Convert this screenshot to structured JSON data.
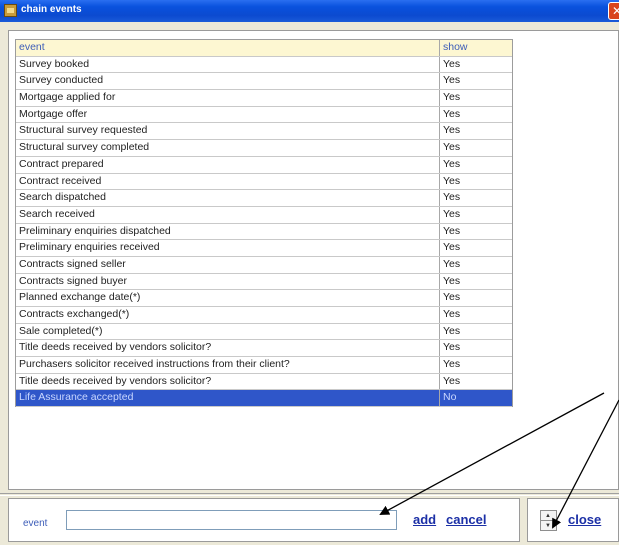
{
  "window": {
    "title": "chain events",
    "close_glyph": "✕"
  },
  "table": {
    "headers": {
      "event": "event",
      "show": "show"
    },
    "rows": [
      {
        "event": "Survey booked",
        "show": "Yes"
      },
      {
        "event": "Survey conducted",
        "show": "Yes"
      },
      {
        "event": "Mortgage applied for",
        "show": "Yes"
      },
      {
        "event": "Mortgage offer",
        "show": "Yes"
      },
      {
        "event": "Structural survey requested",
        "show": "Yes"
      },
      {
        "event": "Structural survey completed",
        "show": "Yes"
      },
      {
        "event": "Contract prepared",
        "show": "Yes"
      },
      {
        "event": "Contract received",
        "show": "Yes"
      },
      {
        "event": "Search dispatched",
        "show": "Yes"
      },
      {
        "event": "Search received",
        "show": "Yes"
      },
      {
        "event": "Preliminary enquiries dispatched",
        "show": "Yes"
      },
      {
        "event": "Preliminary enquiries received",
        "show": "Yes"
      },
      {
        "event": "Contracts signed seller",
        "show": "Yes"
      },
      {
        "event": "Contracts signed buyer",
        "show": "Yes"
      },
      {
        "event": "Planned exchange date(*)",
        "show": "Yes"
      },
      {
        "event": "Contracts exchanged(*)",
        "show": "Yes"
      },
      {
        "event": "Sale completed(*)",
        "show": "Yes"
      },
      {
        "event": "Title deeds received by vendors solicitor?",
        "show": "Yes"
      },
      {
        "event": "Purchasers solicitor received instructions from their client?",
        "show": "Yes"
      },
      {
        "event": "Title deeds received by vendors solicitor?",
        "show": "Yes"
      },
      {
        "event": "Life Assurance accepted",
        "show": "No",
        "selected": true
      }
    ]
  },
  "form": {
    "event_label": "event",
    "event_value": "",
    "add_label": "add",
    "cancel_label": "cancel",
    "close_label": "close",
    "spin_up": "▲",
    "spin_down": "▼"
  },
  "colors": {
    "selection": "#2f56c9",
    "header_bg": "#fdf7d2",
    "link": "#1b2fa6",
    "titlebar": "#0a52de"
  }
}
